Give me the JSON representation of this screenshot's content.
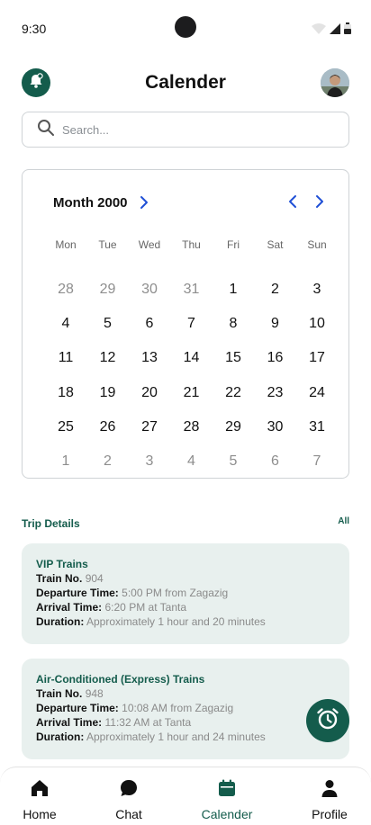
{
  "status": {
    "time": "9:30"
  },
  "header": {
    "title": "Calender"
  },
  "search": {
    "placeholder": "Search..."
  },
  "calendar": {
    "month_label": "Month 2000",
    "weekdays": [
      "Mon",
      "Tue",
      "Wed",
      "Thu",
      "Fri",
      "Sat",
      "Sun"
    ],
    "weeks": [
      [
        {
          "d": "28",
          "muted": true
        },
        {
          "d": "29",
          "muted": true
        },
        {
          "d": "30",
          "muted": true
        },
        {
          "d": "31",
          "muted": true
        },
        {
          "d": "1"
        },
        {
          "d": "2"
        },
        {
          "d": "3"
        }
      ],
      [
        {
          "d": "4"
        },
        {
          "d": "5"
        },
        {
          "d": "6"
        },
        {
          "d": "7"
        },
        {
          "d": "8"
        },
        {
          "d": "9"
        },
        {
          "d": "10"
        }
      ],
      [
        {
          "d": "11"
        },
        {
          "d": "12"
        },
        {
          "d": "13"
        },
        {
          "d": "14"
        },
        {
          "d": "15"
        },
        {
          "d": "16"
        },
        {
          "d": "17"
        }
      ],
      [
        {
          "d": "18"
        },
        {
          "d": "19"
        },
        {
          "d": "20"
        },
        {
          "d": "21"
        },
        {
          "d": "22"
        },
        {
          "d": "23"
        },
        {
          "d": "24"
        }
      ],
      [
        {
          "d": "25"
        },
        {
          "d": "26"
        },
        {
          "d": "27"
        },
        {
          "d": "28"
        },
        {
          "d": "29"
        },
        {
          "d": "30"
        },
        {
          "d": "31"
        }
      ],
      [
        {
          "d": "1",
          "muted": true
        },
        {
          "d": "2",
          "muted": true
        },
        {
          "d": "3",
          "muted": true
        },
        {
          "d": "4",
          "muted": true
        },
        {
          "d": "5",
          "muted": true
        },
        {
          "d": "6",
          "muted": true
        },
        {
          "d": "7",
          "muted": true
        }
      ]
    ]
  },
  "trips": {
    "title": "Trip Details",
    "all_label": "All",
    "train_no_key": "Train No.",
    "departure_key": "Departure Time:",
    "arrival_key": "Arrival Time:",
    "duration_key": "Duration:",
    "cards": [
      {
        "title": "VIP Trains",
        "train_no": "904",
        "departure": "5:00 PM from Zagazig",
        "arrival": "6:20 PM at Tanta",
        "duration": "Approximately 1 hour and 20 minutes"
      },
      {
        "title": "Air-Conditioned (Express) Trains",
        "train_no": "948",
        "departure": "10:08 AM from Zagazig",
        "arrival": "11:32 AM at Tanta",
        "duration": "Approximately 1 hour and 24 minutes"
      }
    ]
  },
  "nav": {
    "items": [
      {
        "label": "Home",
        "icon": "home-icon"
      },
      {
        "label": "Chat",
        "icon": "chat-icon"
      },
      {
        "label": "Calender",
        "icon": "calendar-icon",
        "active": true
      },
      {
        "label": "Profile",
        "icon": "profile-icon"
      }
    ]
  },
  "colors": {
    "accent": "#145c4c",
    "card_bg": "#e8f0ee",
    "muted_text": "#8a8a8a",
    "chevron_blue": "#1f4fd6"
  }
}
